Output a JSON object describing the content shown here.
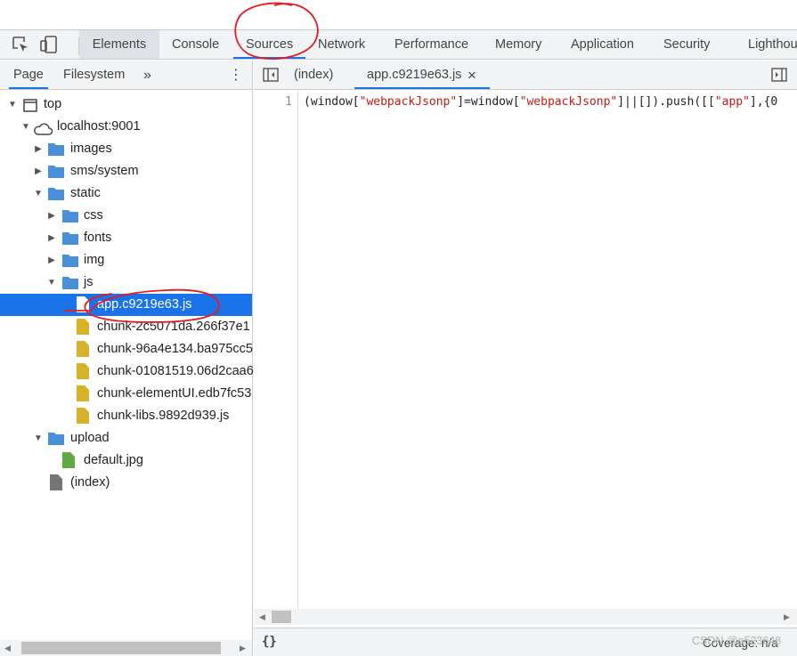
{
  "main_tabs": [
    {
      "label": "Elements"
    },
    {
      "label": "Console"
    },
    {
      "label": "Sources"
    },
    {
      "label": "Network"
    },
    {
      "label": "Performance"
    },
    {
      "label": "Memory"
    },
    {
      "label": "Application"
    },
    {
      "label": "Security"
    },
    {
      "label": "Lighthou"
    }
  ],
  "navigator": {
    "tabs": [
      {
        "label": "Page"
      },
      {
        "label": "Filesystem"
      }
    ],
    "more_symbol": "»",
    "menu_symbol": "⋮"
  },
  "tree": [
    {
      "label": "top"
    },
    {
      "label": "localhost:9001"
    },
    {
      "label": "images"
    },
    {
      "label": "sms/system"
    },
    {
      "label": "static"
    },
    {
      "label": "css"
    },
    {
      "label": "fonts"
    },
    {
      "label": "img"
    },
    {
      "label": "js"
    },
    {
      "label": "app.c9219e63.js"
    },
    {
      "label": "chunk-2c5071da.266f37e1"
    },
    {
      "label": "chunk-96a4e134.ba975cc5"
    },
    {
      "label": "chunk-01081519.06d2caa6"
    },
    {
      "label": "chunk-elementUI.edb7fc53"
    },
    {
      "label": "chunk-libs.9892d939.js"
    },
    {
      "label": "upload"
    },
    {
      "label": "default.jpg"
    },
    {
      "label": "(index)"
    }
  ],
  "editor": {
    "tabs": [
      {
        "label": "(index)"
      },
      {
        "label": "app.c9219e63.js"
      }
    ],
    "close_symbol": "×",
    "line_number": "1",
    "code": {
      "p1": "(window[",
      "s1": "\"webpackJsonp\"",
      "p2": "]=window[",
      "s2": "\"webpackJsonp\"",
      "p3": "]||[]).push([[",
      "s3": "\"app\"",
      "p4": "],{0"
    }
  },
  "status": {
    "pretty_print": "{}",
    "coverage": "Coverage: n/a",
    "watermark": "CSDN @a523648"
  },
  "colors": {
    "accent": "#1a73e8",
    "folder": "#4a90d9",
    "js_file": "#d6b12a",
    "image_file": "#5fa843",
    "annotation": "#e31b23"
  }
}
